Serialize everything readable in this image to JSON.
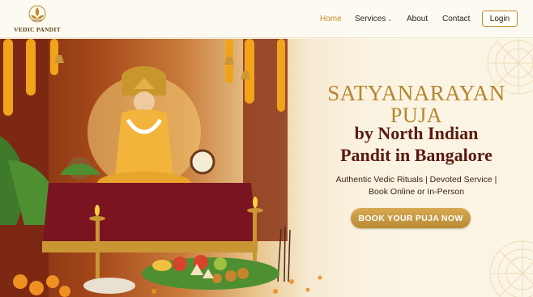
{
  "brand": {
    "name": "VEDIC PANDIT",
    "icon": "lotus-deity-logo"
  },
  "nav": {
    "items": [
      {
        "label": "Home",
        "active": true
      },
      {
        "label": "Services",
        "has_dropdown": true
      },
      {
        "label": "About"
      },
      {
        "label": "Contact"
      }
    ],
    "login_label": "Login"
  },
  "hero": {
    "title_line1": "SATYANARAYAN",
    "title_line2": "PUJA",
    "title_line3": "by North Indian",
    "title_line4": "Pandit in Bangalore",
    "subtitle_line1": "Authentic Vedic Rituals | Devoted Service |",
    "subtitle_line2": "Book Online or In-Person",
    "cta_label": "BOOK YOUR PUJA NOW",
    "image": "lord-vishnu-puja-altar-illustration"
  },
  "colors": {
    "accent_gold": "#c08a2a",
    "title_gold": "#b4862e",
    "title_maroon": "#5a1a10",
    "background": "#fbf6ea"
  }
}
